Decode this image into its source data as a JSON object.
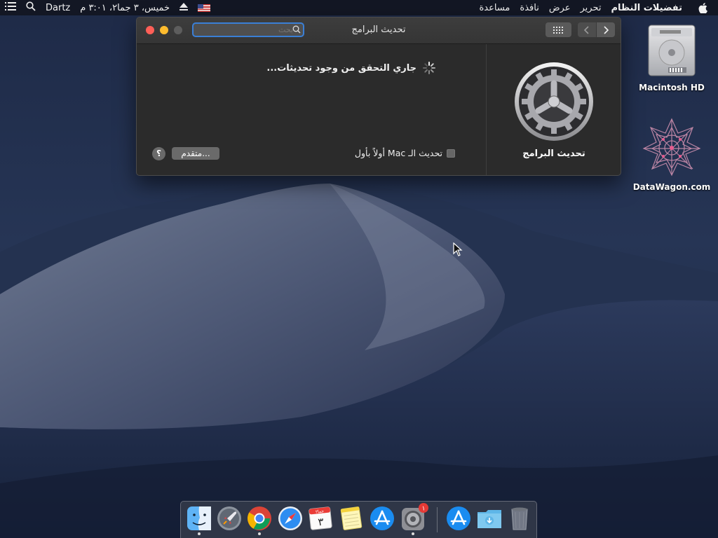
{
  "menubar": {
    "app_name": "تفضيلات النظام",
    "items": [
      "تحرير",
      "عرض",
      "نافذة",
      "مساعدة"
    ],
    "clock": "خميس، ٣ جما٢، ٣:٠١ م",
    "user": "Dartz"
  },
  "window": {
    "title": "تحديث البرامج",
    "search_placeholder": "بحث",
    "pref_name": "تحديث البرامج",
    "status_text": "جاري التحقق من وجود تحديثات...",
    "auto_update_label": "تحديث الـ Mac أولاً بأول",
    "auto_update_checked": false,
    "advanced_label": "متقدم...",
    "help_label": "؟"
  },
  "desktop": {
    "icons": [
      {
        "label": "Macintosh HD",
        "icon": "hard-drive-icon"
      },
      {
        "label": "DataWagon.com",
        "icon": "datawagon-logo-icon"
      }
    ]
  },
  "dock": {
    "apps": [
      {
        "name": "finder",
        "running": true
      },
      {
        "name": "launchpad",
        "running": false
      },
      {
        "name": "chrome",
        "running": true
      },
      {
        "name": "safari",
        "running": false
      },
      {
        "name": "calendar",
        "running": false,
        "date_text": "٣",
        "month_text": "جما٢"
      },
      {
        "name": "notes",
        "running": false
      },
      {
        "name": "app-store",
        "running": false
      },
      {
        "name": "system-preferences",
        "running": true,
        "badge": "١"
      },
      {
        "name": "app-store-downloads",
        "running": false
      },
      {
        "name": "downloads-folder",
        "running": false
      },
      {
        "name": "trash",
        "running": false
      }
    ]
  },
  "colors": {
    "accent": "#3a7fd6",
    "close": "#ff5f57",
    "minimize": "#febc2e"
  }
}
